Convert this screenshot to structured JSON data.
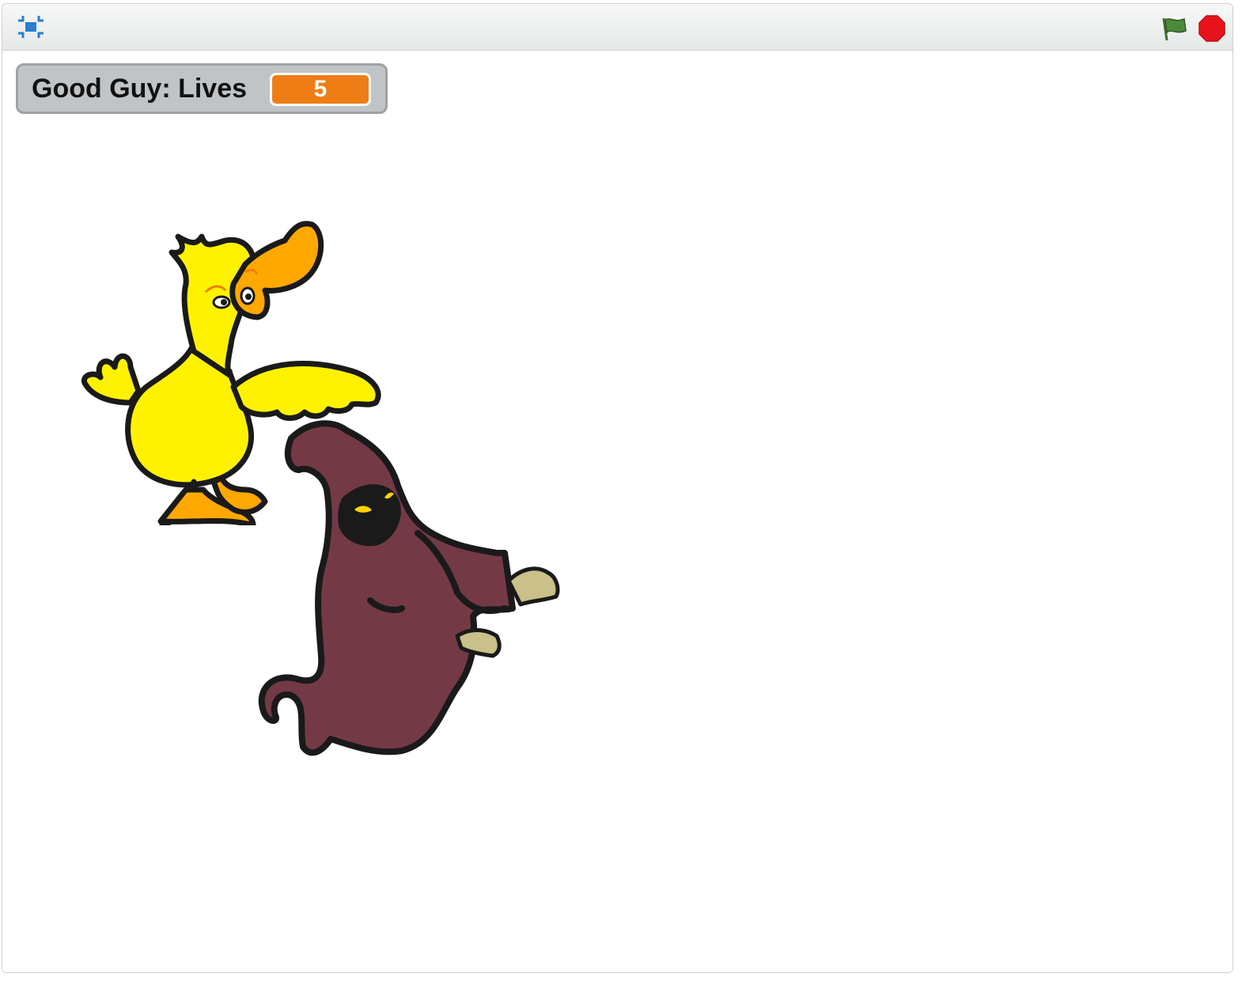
{
  "toolbar": {
    "fullscreen_icon": "fullscreen-icon",
    "green_flag_icon": "green-flag-icon",
    "stop_icon": "stop-sign-icon",
    "colors": {
      "flag": "#4a8a3a",
      "stop": "#e8121b",
      "fullscreen": "#2a7fd0"
    }
  },
  "monitor": {
    "label": "Good Guy: Lives",
    "value": "5",
    "value_color": "#ee7d16"
  },
  "sprites": [
    {
      "name": "duck",
      "color": "#fff200"
    },
    {
      "name": "ghost",
      "color": "#733a46"
    }
  ]
}
